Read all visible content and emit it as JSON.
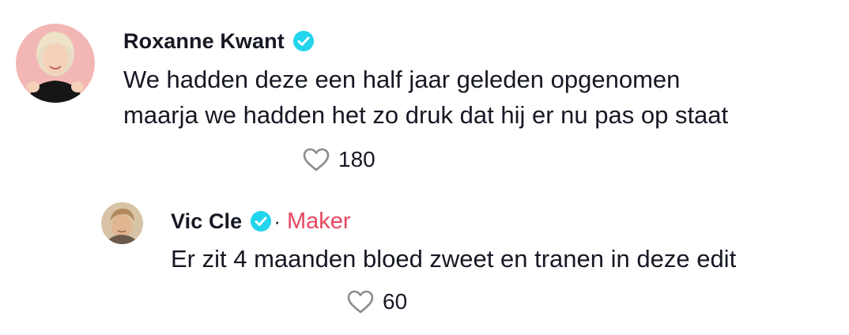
{
  "comments": [
    {
      "author": "Roxanne Kwant",
      "verified": true,
      "lines": [
        "We hadden deze een half jaar geleden opgenomen",
        "maarja we hadden het zo druk dat hij er nu pas op staat"
      ],
      "likes": "180",
      "like_icon": "heart-outline-icon"
    }
  ],
  "reply": {
    "author": "Vic Cle",
    "verified": true,
    "separator": "·",
    "badge": "Maker",
    "text": "Er zit 4 maanden bloed zweet en tranen in deze edit",
    "likes": "60",
    "like_icon": "heart-outline-icon"
  },
  "colors": {
    "verified": "#20d5ec",
    "maker": "#e8465f",
    "text": "#161823",
    "icon": "#8a8b91"
  }
}
